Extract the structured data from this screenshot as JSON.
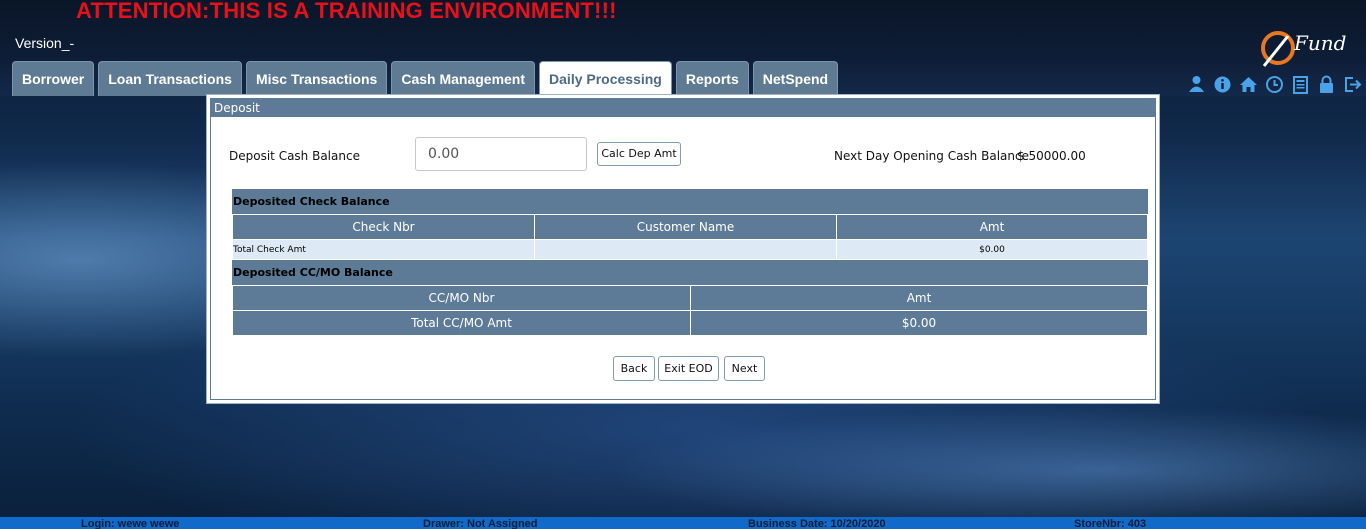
{
  "banner": {
    "attention": "ATTENTION:THIS IS A TRAINING ENVIRONMENT!!!",
    "version": "Version_-"
  },
  "logo": {
    "text": "Fund"
  },
  "tabs": [
    {
      "label": "Borrower",
      "active": false
    },
    {
      "label": "Loan Transactions",
      "active": false
    },
    {
      "label": "Misc Transactions",
      "active": false
    },
    {
      "label": "Cash Management",
      "active": false
    },
    {
      "label": "Daily Processing",
      "active": true
    },
    {
      "label": "Reports",
      "active": false
    },
    {
      "label": "NetSpend",
      "active": false
    }
  ],
  "toolbar_icons": [
    "user-icon",
    "info-icon",
    "home-icon",
    "clock-icon",
    "calculator-icon",
    "lock-icon",
    "logout-icon"
  ],
  "deposit": {
    "title": "Deposit",
    "cash_balance_label": "Deposit Cash Balance",
    "cash_balance_value": "0.00",
    "calc_button": "Calc Dep Amt",
    "next_day_label": "Next Day Opening Cash Balance",
    "next_day_value": "$ 50000.00",
    "check_section": {
      "title": "Deposited Check Balance",
      "columns": [
        "Check Nbr",
        "Customer Name",
        "Amt"
      ],
      "total_label": "Total Check Amt",
      "total_value": "$0.00"
    },
    "ccmo_section": {
      "title": "Deposited CC/MO Balance",
      "columns": [
        "CC/MO Nbr",
        "Amt"
      ],
      "total_label": "Total CC/MO Amt",
      "total_value": "$0.00"
    },
    "buttons": {
      "back": "Back",
      "exit": "Exit EOD",
      "next": "Next"
    }
  },
  "status_bar": {
    "login": "Login: wewe wewe",
    "drawer": "Drawer: Not Assigned",
    "business_date": "Business Date: 10/20/2020",
    "store": "StoreNbr: 403"
  },
  "colors": {
    "attention": "#e8111b",
    "tab": "#5f7a93",
    "section": "#5d7a97",
    "status": "#1169c9"
  }
}
